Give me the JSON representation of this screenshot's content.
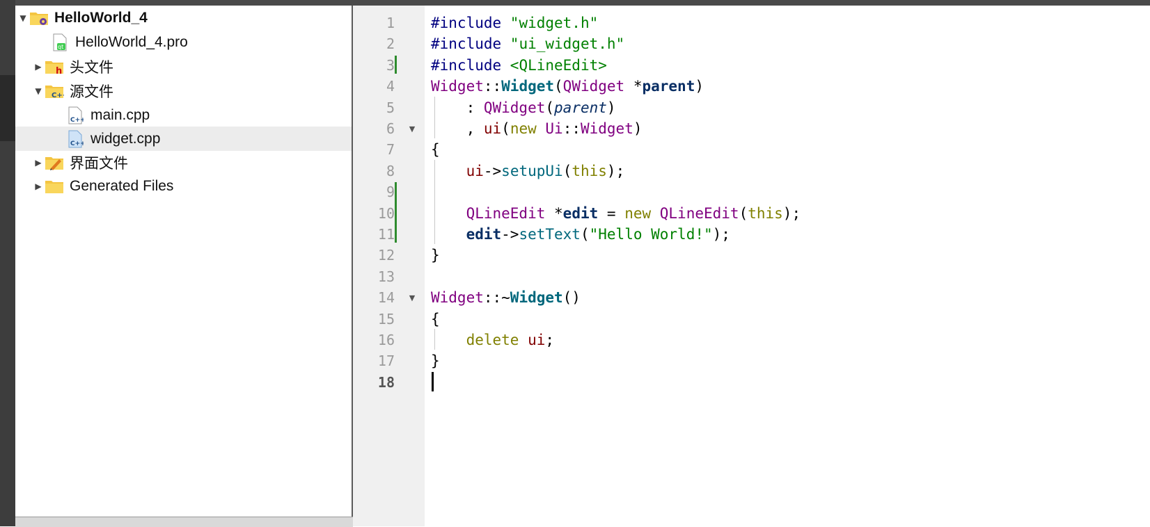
{
  "project_tree": {
    "items": [
      {
        "label": "HelloWorld_4",
        "expanded": true,
        "icon": "project-folder-icon"
      },
      {
        "label": "HelloWorld_4.pro",
        "icon": "qt-pro-file-icon"
      },
      {
        "label": "头文件",
        "expanded": false,
        "icon": "headers-folder-icon"
      },
      {
        "label": "源文件",
        "expanded": true,
        "icon": "sources-folder-icon"
      },
      {
        "label": "main.cpp",
        "icon": "cpp-file-icon"
      },
      {
        "label": "widget.cpp",
        "icon": "cpp-file-icon",
        "selected": true
      },
      {
        "label": "界面文件",
        "expanded": false,
        "icon": "forms-folder-icon"
      },
      {
        "label": "Generated Files",
        "expanded": false,
        "icon": "folder-icon"
      }
    ]
  },
  "editor": {
    "current_line": 18,
    "line_numbers": [
      "1",
      "2",
      "3",
      "4",
      "5",
      "6",
      "7",
      "8",
      "9",
      "10",
      "11",
      "12",
      "13",
      "14",
      "15",
      "16",
      "17",
      "18"
    ],
    "lines": [
      [
        {
          "t": "#include ",
          "c": "k-pre"
        },
        {
          "t": "\"widget.h\"",
          "c": "k-str"
        }
      ],
      [
        {
          "t": "#include ",
          "c": "k-pre"
        },
        {
          "t": "\"ui_widget.h\"",
          "c": "k-str"
        }
      ],
      [
        {
          "t": "#include ",
          "c": "k-pre"
        },
        {
          "t": "<QLineEdit>",
          "c": "k-str"
        }
      ],
      [
        {
          "t": "Widget",
          "c": "k-cls"
        },
        {
          "t": "::",
          "c": "k-plain"
        },
        {
          "t": "Widget",
          "c": "k-fn"
        },
        {
          "t": "(",
          "c": "k-plain"
        },
        {
          "t": "QWidget",
          "c": "k-cls"
        },
        {
          "t": " *",
          "c": "k-plain"
        },
        {
          "t": "parent",
          "c": "k-param"
        },
        {
          "t": ")",
          "c": "k-plain"
        }
      ],
      [
        {
          "t": "    : ",
          "c": "k-plain"
        },
        {
          "t": "QWidget",
          "c": "k-cls"
        },
        {
          "t": "(",
          "c": "k-plain"
        },
        {
          "t": "parent",
          "c": "k-it"
        },
        {
          "t": ")",
          "c": "k-plain"
        }
      ],
      [
        {
          "t": "    , ",
          "c": "k-plain"
        },
        {
          "t": "ui",
          "c": "k-field"
        },
        {
          "t": "(",
          "c": "k-plain"
        },
        {
          "t": "new ",
          "c": "k-kw"
        },
        {
          "t": "Ui",
          "c": "k-cls"
        },
        {
          "t": "::",
          "c": "k-plain"
        },
        {
          "t": "Widget",
          "c": "k-cls"
        },
        {
          "t": ")",
          "c": "k-plain"
        }
      ],
      [
        {
          "t": "{",
          "c": "k-plain"
        }
      ],
      [
        {
          "t": "    ",
          "c": "k-plain"
        },
        {
          "t": "ui",
          "c": "k-field"
        },
        {
          "t": "->",
          "c": "k-plain"
        },
        {
          "t": "setupUi",
          "c": "k-fncall"
        },
        {
          "t": "(",
          "c": "k-plain"
        },
        {
          "t": "this",
          "c": "k-kw"
        },
        {
          "t": ");",
          "c": "k-plain"
        }
      ],
      [
        {
          "t": "",
          "c": "k-plain"
        }
      ],
      [
        {
          "t": "    ",
          "c": "k-plain"
        },
        {
          "t": "QLineEdit",
          "c": "k-cls"
        },
        {
          "t": " *",
          "c": "k-plain"
        },
        {
          "t": "edit",
          "c": "k-param"
        },
        {
          "t": " = ",
          "c": "k-plain"
        },
        {
          "t": "new ",
          "c": "k-kw"
        },
        {
          "t": "QLineEdit",
          "c": "k-cls"
        },
        {
          "t": "(",
          "c": "k-plain"
        },
        {
          "t": "this",
          "c": "k-kw"
        },
        {
          "t": ");",
          "c": "k-plain"
        }
      ],
      [
        {
          "t": "    ",
          "c": "k-plain"
        },
        {
          "t": "edit",
          "c": "k-param"
        },
        {
          "t": "->",
          "c": "k-plain"
        },
        {
          "t": "setText",
          "c": "k-fncall"
        },
        {
          "t": "(",
          "c": "k-plain"
        },
        {
          "t": "\"Hello World!\"",
          "c": "k-str"
        },
        {
          "t": ");",
          "c": "k-plain"
        }
      ],
      [
        {
          "t": "}",
          "c": "k-plain"
        }
      ],
      [
        {
          "t": "",
          "c": "k-plain"
        }
      ],
      [
        {
          "t": "Widget",
          "c": "k-cls"
        },
        {
          "t": "::~",
          "c": "k-plain"
        },
        {
          "t": "Widget",
          "c": "k-fn"
        },
        {
          "t": "()",
          "c": "k-plain"
        }
      ],
      [
        {
          "t": "{",
          "c": "k-plain"
        }
      ],
      [
        {
          "t": "    ",
          "c": "k-plain"
        },
        {
          "t": "delete ",
          "c": "k-kw"
        },
        {
          "t": "ui",
          "c": "k-field"
        },
        {
          "t": ";",
          "c": "k-plain"
        }
      ],
      [
        {
          "t": "}",
          "c": "k-plain"
        }
      ],
      [
        {
          "t": "",
          "c": "k-plain"
        }
      ]
    ]
  }
}
